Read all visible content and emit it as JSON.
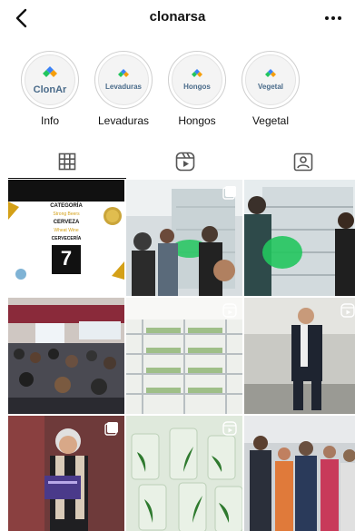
{
  "header": {
    "username": "clonarsa"
  },
  "highlights": [
    {
      "label": "Info",
      "cover_text": "ClonAr"
    },
    {
      "label": "Levaduras",
      "cover_text": "Levaduras"
    },
    {
      "label": "Hongos",
      "cover_text": "Hongos"
    },
    {
      "label": "Vegetal",
      "cover_text": "Vegetal"
    }
  ],
  "tabs": [
    {
      "icon": "grid-icon",
      "active": true
    },
    {
      "icon": "reels-icon",
      "active": false
    },
    {
      "icon": "tagged-icon",
      "active": false
    }
  ],
  "posts": [
    {
      "type": "image",
      "overlay": {
        "category": "CATEGORÍA",
        "subcategory": "Strong Beers",
        "section": "CERVEZA",
        "item": "Wheat Wine",
        "footer": "CERVECERÍA",
        "number": "7"
      }
    },
    {
      "type": "carousel"
    },
    {
      "type": "image"
    },
    {
      "type": "image"
    },
    {
      "type": "reel"
    },
    {
      "type": "reel"
    },
    {
      "type": "carousel"
    },
    {
      "type": "reel"
    },
    {
      "type": "image"
    }
  ],
  "colors": {
    "accent_green": "#22c55e",
    "gold": "#d4a017",
    "text": "#111111"
  }
}
